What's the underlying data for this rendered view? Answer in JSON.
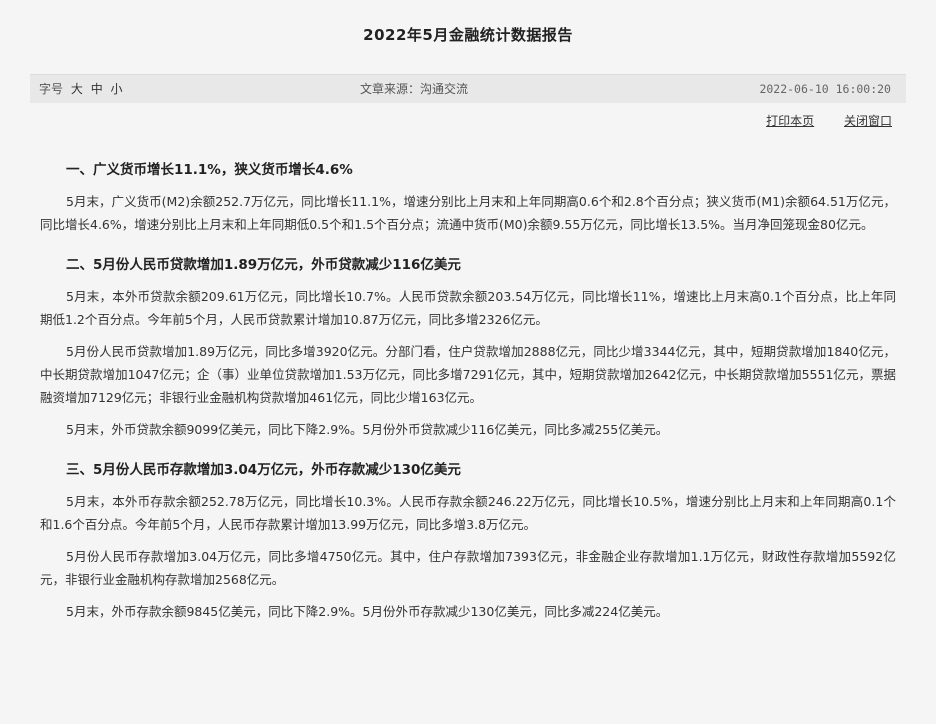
{
  "article": {
    "title": "2022年5月金融统计数据报告"
  },
  "meta": {
    "font_label": "字号",
    "font_sizes": [
      "大",
      "中",
      "小"
    ],
    "source": "文章来源：沟通交流",
    "datetime": "2022-06-10 16:00:20"
  },
  "tools": {
    "print": "打印本页",
    "close": "关闭窗口"
  },
  "sections": [
    {
      "heading": "一、广义货币增长11.1%，狭义货币增长4.6%",
      "paragraphs": [
        "5月末，广义货币(M2)余额252.7万亿元，同比增长11.1%，增速分别比上月末和上年同期高0.6个和2.8个百分点；狭义货币(M1)余额64.51万亿元，同比增长4.6%，增速分别比上月末和上年同期低0.5个和1.5个百分点；流通中货币(M0)余额9.55万亿元，同比增长13.5%。当月净回笼现金80亿元。"
      ]
    },
    {
      "heading": "二、5月份人民币贷款增加1.89万亿元，外币贷款减少116亿美元",
      "paragraphs": [
        "5月末，本外币贷款余额209.61万亿元，同比增长10.7%。人民币贷款余额203.54万亿元，同比增长11%，增速比上月末高0.1个百分点，比上年同期低1.2个百分点。今年前5个月，人民币贷款累计增加10.87万亿元，同比多增2326亿元。",
        "5月份人民币贷款增加1.89万亿元，同比多增3920亿元。分部门看，住户贷款增加2888亿元，同比少增3344亿元，其中，短期贷款增加1840亿元，中长期贷款增加1047亿元；企（事）业单位贷款增加1.53万亿元，同比多增7291亿元，其中，短期贷款增加2642亿元，中长期贷款增加5551亿元，票据融资增加7129亿元；非银行业金融机构贷款增加461亿元，同比少增163亿元。",
        "5月末，外币贷款余额9099亿美元，同比下降2.9%。5月份外币贷款减少116亿美元，同比多减255亿美元。"
      ]
    },
    {
      "heading": "三、5月份人民币存款增加3.04万亿元，外币存款减少130亿美元",
      "paragraphs": [
        "5月末，本外币存款余额252.78万亿元，同比增长10.3%。人民币存款余额246.22万亿元，同比增长10.5%，增速分别比上月末和上年同期高0.1个和1.6个百分点。今年前5个月，人民币存款累计增加13.99万亿元，同比多增3.8万亿元。",
        "5月份人民币存款增加3.04万亿元，同比多增4750亿元。其中，住户存款增加7393亿元，非金融企业存款增加1.1万亿元，财政性存款增加5592亿元，非银行业金融机构存款增加2568亿元。",
        "5月末，外币存款余额9845亿美元，同比下降2.9%。5月份外币存款减少130亿美元，同比多减224亿美元。"
      ]
    }
  ]
}
